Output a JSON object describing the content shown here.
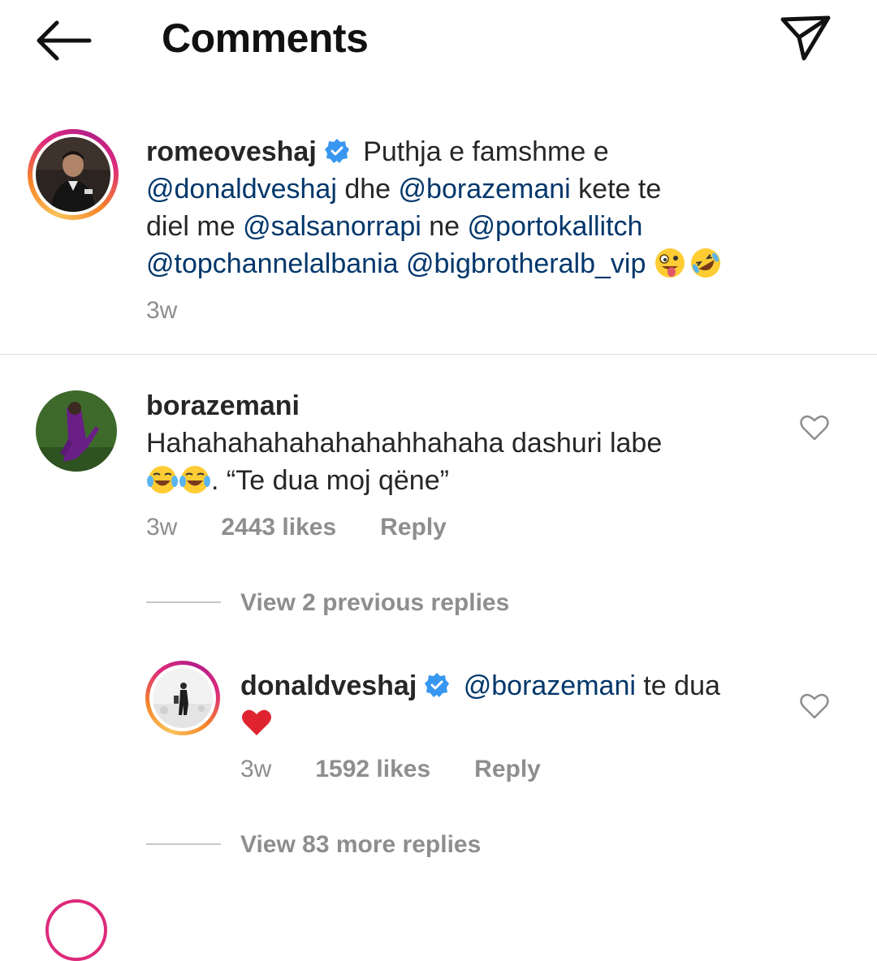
{
  "header": {
    "title": "Comments",
    "back_icon": "arrow-left-icon",
    "send_icon": "paper-plane-icon"
  },
  "caption": {
    "username": "romeoveshaj",
    "verified": true,
    "text_1": "Puthja e famshme e",
    "mention_1": "@donaldveshaj",
    "text_2": "dhe",
    "mention_2": "@borazemani",
    "text_3": "kete te",
    "text_4": "diel me",
    "mention_3": "@salsanorrapi",
    "text_5": "ne",
    "mention_4": "@portokallitch",
    "mention_5": "@topchannelalbania",
    "mention_6": "@bigbrotheralb_vip",
    "emojis": [
      "zany-face-emoji",
      "rolling-laughing-emoji"
    ],
    "time": "3w"
  },
  "comment": {
    "username": "borazemani",
    "text_1": "Hahahahahahahahahhahaha dashuri labe",
    "text_2": ". “Te dua moj qëne”",
    "emojis": [
      "tears-of-joy-emoji",
      "tears-of-joy-emoji"
    ],
    "time": "3w",
    "likes": "2443 likes",
    "reply": "Reply"
  },
  "view_previous": "View 2 previous replies",
  "reply": {
    "username": "donaldveshaj",
    "verified": true,
    "mention": "@borazemani",
    "text": "te dua",
    "emoji": "red-heart-emoji",
    "time": "3w",
    "likes": "1592 likes",
    "reply": "Reply"
  },
  "view_more": "View 83 more replies",
  "colors": {
    "mention": "#00376b",
    "verified": "#3897f0",
    "meta": "#8e8e8e",
    "divider": "#dbdbdb"
  }
}
